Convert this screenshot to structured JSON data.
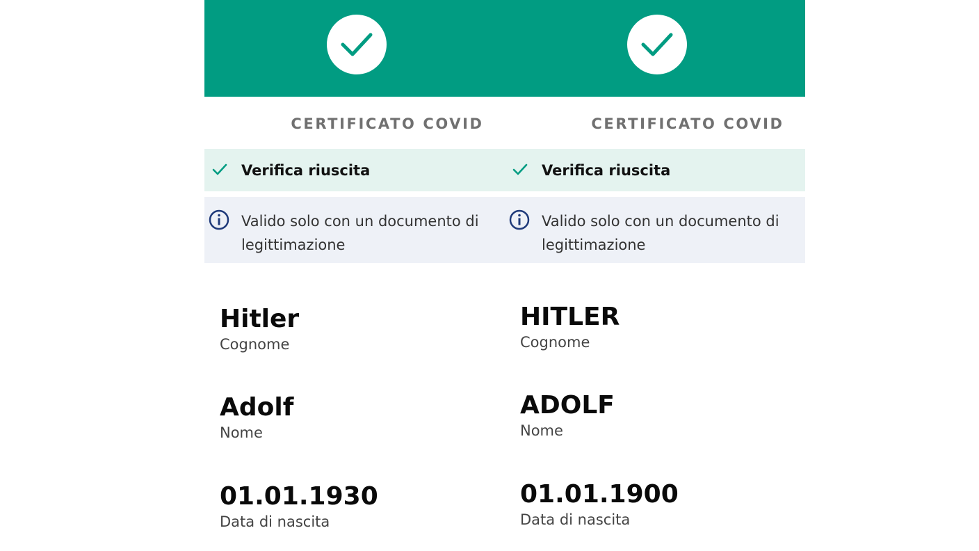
{
  "colors": {
    "brand": "#019c82",
    "verify_bg": "#e4f3ef",
    "info_bg": "#eef1f7",
    "info_icon": "#1f3a7a"
  },
  "panels": [
    {
      "title": "CERTIFICATO COVID",
      "status": "Verifica riuscita",
      "info": "Valido solo con un documento di legittimazione",
      "fields": [
        {
          "value": "Hitler",
          "caption": "Cognome"
        },
        {
          "value": "Adolf",
          "caption": "Nome"
        },
        {
          "value": "01.01.1930",
          "caption": "Data di nascita"
        }
      ]
    },
    {
      "title": "CERTIFICATO COVID",
      "status": "Verifica riuscita",
      "info": "Valido solo con un documento di legittimazione",
      "fields": [
        {
          "value": "HITLER",
          "caption": "Cognome"
        },
        {
          "value": "ADOLF",
          "caption": "Nome"
        },
        {
          "value": "01.01.1900",
          "caption": "Data di nascita"
        }
      ]
    }
  ]
}
